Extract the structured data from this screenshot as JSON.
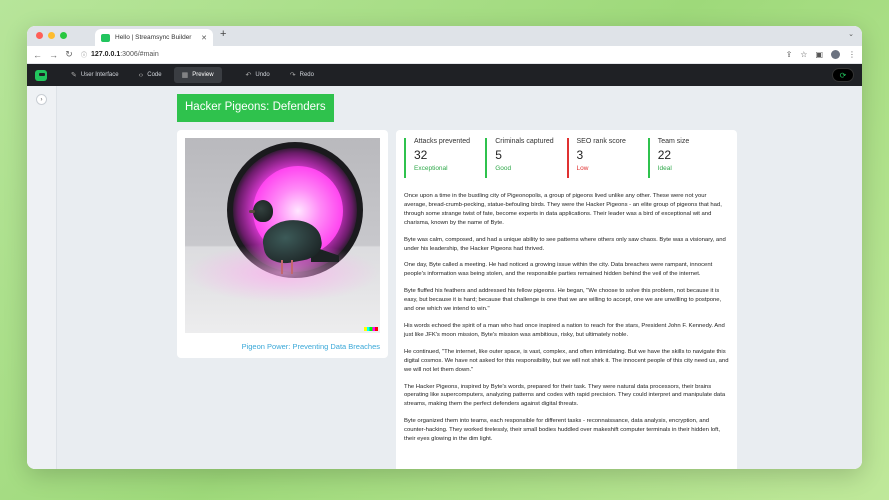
{
  "browser": {
    "tab_title": "Hello | Streamsync Builder",
    "url_host": "127.0.0.1",
    "url_path": ":3006/#main",
    "traffic_colors": [
      "#ff5f57",
      "#febc2e",
      "#28c840"
    ]
  },
  "toolbar": {
    "user_interface": "User Interface",
    "code": "Code",
    "preview": "Preview",
    "undo": "Undo",
    "redo": "Redo"
  },
  "page": {
    "header": "Hacker Pigeons: Defenders",
    "image_caption": "Pigeon Power: Preventing Data Breaches",
    "accent_color": "#2fc24d"
  },
  "metrics": [
    {
      "label": "Attacks prevented",
      "value": "32",
      "note": "Exceptional",
      "status": "good"
    },
    {
      "label": "Criminals captured",
      "value": "5",
      "note": "Good",
      "status": "good"
    },
    {
      "label": "SEO rank score",
      "value": "3",
      "note": "Low",
      "status": "bad"
    },
    {
      "label": "Team size",
      "value": "22",
      "note": "Ideal",
      "status": "good"
    }
  ],
  "story": [
    "Once upon a time in the bustling city of Pigeonopolis, a group of pigeons lived unlike any other. These were not your average, bread-crumb-pecking, statue-befouling birds. They were the Hacker Pigeons - an elite group of pigeons that had, through some strange twist of fate, become experts in data applications. Their leader was a bird of exceptional wit and charisma, known by the name of Byte.",
    "Byte was calm, composed, and had a unique ability to see patterns where others only saw chaos. Byte was a visionary, and under his leadership, the Hacker Pigeons had thrived.",
    "One day, Byte called a meeting. He had noticed a growing issue within the city. Data breaches were rampant, innocent people's information was being stolen, and the responsible parties remained hidden behind the veil of the internet.",
    "Byte fluffed his feathers and addressed his fellow pigeons. He began, \"We choose to solve this problem, not because it is easy, but because it is hard; because that challenge is one that we are willing to accept, one we are unwilling to postpone, and one which we intend to win.\"",
    "His words echoed the spirit of a man who had once inspired a nation to reach for the stars, President John F. Kennedy. And just like JFK's moon mission, Byte's mission was ambitious, risky, but ultimately noble.",
    "He continued, \"The internet, like outer space, is vast, complex, and often intimidating. But we have the skills to navigate this digital cosmos. We have not asked for this responsibility, but we will not shirk it. The innocent people of this city need us, and we will not let them down.\"",
    "The Hacker Pigeons, inspired by Byte's words, prepared for their task. They were natural data processors, their brains operating like supercomputers, analyzing patterns and codes with rapid precision. They could interpret and manipulate data streams, making them the perfect defenders against digital threats.",
    "Byte organized them into teams, each responsible for different tasks - reconnaissance, data analysis, encryption, and counter-hacking. They worked tirelessly, their small bodies huddled over makeshift computer terminals in their hidden loft, their eyes glowing in the dim light."
  ]
}
